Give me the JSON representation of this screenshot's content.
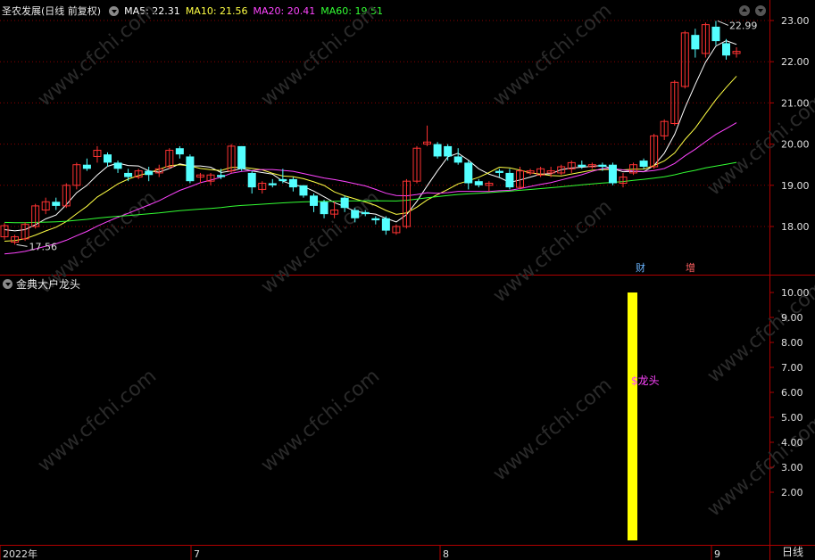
{
  "header": {
    "stock": "圣农发展(日线 前复权)",
    "ma": [
      {
        "label": "MA5: 22.31",
        "color": "#ffffff"
      },
      {
        "label": "MA10: 21.56",
        "color": "#ffff44"
      },
      {
        "label": "MA20: 20.41",
        "color": "#ff44ff"
      },
      {
        "label": "MA60: 19.51",
        "color": "#33ff33"
      }
    ]
  },
  "indicator": {
    "title": "金典大户龙头",
    "signal_label": "$龙头",
    "signal_value": 10.0
  },
  "tags": {
    "finance": "财",
    "increase": "增"
  },
  "period": "日线",
  "price_axis": [
    "23.00",
    "22.00",
    "21.00",
    "20.00",
    "19.00",
    "18.00"
  ],
  "ind_axis": [
    "10.00",
    "9.00",
    "8.00",
    "7.00",
    "6.00",
    "5.00",
    "4.00",
    "3.00",
    "2.00"
  ],
  "time_axis": [
    "2022年",
    "7",
    "8",
    "9"
  ],
  "annotations": {
    "high": "22.99",
    "low": "17.56"
  },
  "watermark": "www.cfchi.com",
  "colors": {
    "up": "#ff3232",
    "down": "#54ffff",
    "grid": "#8b0000",
    "ma5": "#ffffff",
    "ma10": "#ffff44",
    "ma20": "#ff44ff",
    "ma60": "#33ff33",
    "signal": "#ffff00"
  },
  "chart_data": {
    "type": "candlestick",
    "ylim": [
      17.5,
      23.3
    ],
    "candles": [
      [
        17.75,
        18.02,
        17.68,
        18.08
      ],
      [
        17.62,
        17.75,
        17.56,
        17.8
      ],
      [
        17.7,
        18.05,
        17.65,
        18.1
      ],
      [
        18.0,
        18.5,
        17.95,
        18.55
      ],
      [
        18.4,
        18.6,
        18.3,
        18.7
      ],
      [
        18.6,
        18.5,
        18.4,
        18.7
      ],
      [
        18.5,
        19.0,
        18.45,
        19.05
      ],
      [
        19.0,
        19.5,
        18.9,
        19.55
      ],
      [
        19.5,
        19.4,
        19.35,
        19.65
      ],
      [
        19.7,
        19.85,
        19.55,
        19.95
      ],
      [
        19.75,
        19.55,
        19.45,
        19.8
      ],
      [
        19.55,
        19.4,
        19.3,
        19.6
      ],
      [
        19.3,
        19.2,
        19.1,
        19.4
      ],
      [
        19.2,
        19.35,
        19.15,
        19.4
      ],
      [
        19.35,
        19.25,
        19.1,
        19.45
      ],
      [
        19.3,
        19.4,
        19.2,
        19.5
      ],
      [
        19.45,
        19.85,
        19.4,
        19.9
      ],
      [
        19.9,
        19.75,
        19.65,
        19.95
      ],
      [
        19.7,
        19.1,
        19.05,
        19.75
      ],
      [
        19.2,
        19.25,
        19.05,
        19.3
      ],
      [
        19.1,
        19.25,
        19.0,
        19.3
      ],
      [
        19.25,
        19.2,
        19.15,
        19.4
      ],
      [
        19.35,
        19.95,
        19.3,
        20.0
      ],
      [
        19.95,
        19.4,
        19.35,
        19.95
      ],
      [
        19.3,
        18.95,
        18.8,
        19.35
      ],
      [
        18.9,
        19.05,
        18.8,
        19.1
      ],
      [
        19.05,
        19.0,
        18.95,
        19.15
      ],
      [
        19.15,
        19.1,
        19.05,
        19.4
      ],
      [
        19.15,
        18.95,
        18.85,
        19.2
      ],
      [
        19.0,
        18.75,
        18.7,
        19.0
      ],
      [
        18.75,
        18.5,
        18.35,
        18.8
      ],
      [
        18.6,
        18.3,
        18.2,
        18.65
      ],
      [
        18.3,
        18.4,
        18.2,
        18.6
      ],
      [
        18.7,
        18.45,
        18.35,
        18.75
      ],
      [
        18.4,
        18.2,
        18.1,
        18.45
      ],
      [
        18.35,
        18.3,
        18.25,
        18.4
      ],
      [
        18.2,
        18.15,
        18.05,
        18.25
      ],
      [
        18.2,
        17.9,
        17.8,
        18.25
      ],
      [
        17.85,
        18.0,
        17.8,
        18.05
      ],
      [
        18.0,
        19.1,
        17.95,
        19.15
      ],
      [
        19.1,
        19.9,
        19.05,
        19.95
      ],
      [
        20.0,
        20.05,
        19.95,
        20.45
      ],
      [
        20.0,
        19.7,
        19.65,
        20.05
      ],
      [
        19.95,
        19.7,
        19.6,
        20.0
      ],
      [
        19.7,
        19.55,
        19.5,
        19.9
      ],
      [
        19.55,
        19.05,
        18.9,
        19.6
      ],
      [
        19.1,
        19.0,
        18.95,
        19.15
      ],
      [
        19.0,
        19.05,
        18.85,
        19.1
      ],
      [
        19.35,
        19.3,
        19.2,
        19.4
      ],
      [
        19.3,
        18.95,
        18.9,
        19.4
      ],
      [
        18.95,
        19.35,
        18.9,
        19.45
      ],
      [
        19.3,
        19.35,
        19.25,
        19.4
      ],
      [
        19.25,
        19.4,
        19.2,
        19.45
      ],
      [
        19.3,
        19.35,
        19.2,
        19.45
      ],
      [
        19.3,
        19.45,
        19.25,
        19.5
      ],
      [
        19.4,
        19.55,
        19.3,
        19.6
      ],
      [
        19.5,
        19.45,
        19.4,
        19.6
      ],
      [
        19.45,
        19.5,
        19.4,
        19.55
      ],
      [
        19.5,
        19.45,
        19.35,
        19.55
      ],
      [
        19.5,
        19.05,
        19.0,
        19.55
      ],
      [
        19.05,
        19.2,
        18.95,
        19.3
      ],
      [
        19.3,
        19.5,
        19.25,
        19.55
      ],
      [
        19.6,
        19.45,
        19.4,
        19.65
      ],
      [
        19.45,
        20.2,
        19.4,
        20.25
      ],
      [
        20.2,
        20.55,
        20.1,
        20.6
      ],
      [
        20.5,
        21.5,
        20.45,
        21.55
      ],
      [
        21.4,
        22.7,
        21.35,
        22.75
      ],
      [
        22.65,
        22.3,
        22.1,
        22.8
      ],
      [
        22.2,
        22.9,
        22.1,
        22.95
      ],
      [
        22.85,
        22.5,
        22.4,
        22.99
      ],
      [
        22.45,
        22.15,
        22.05,
        22.55
      ],
      [
        22.2,
        22.25,
        22.1,
        22.35
      ]
    ]
  }
}
